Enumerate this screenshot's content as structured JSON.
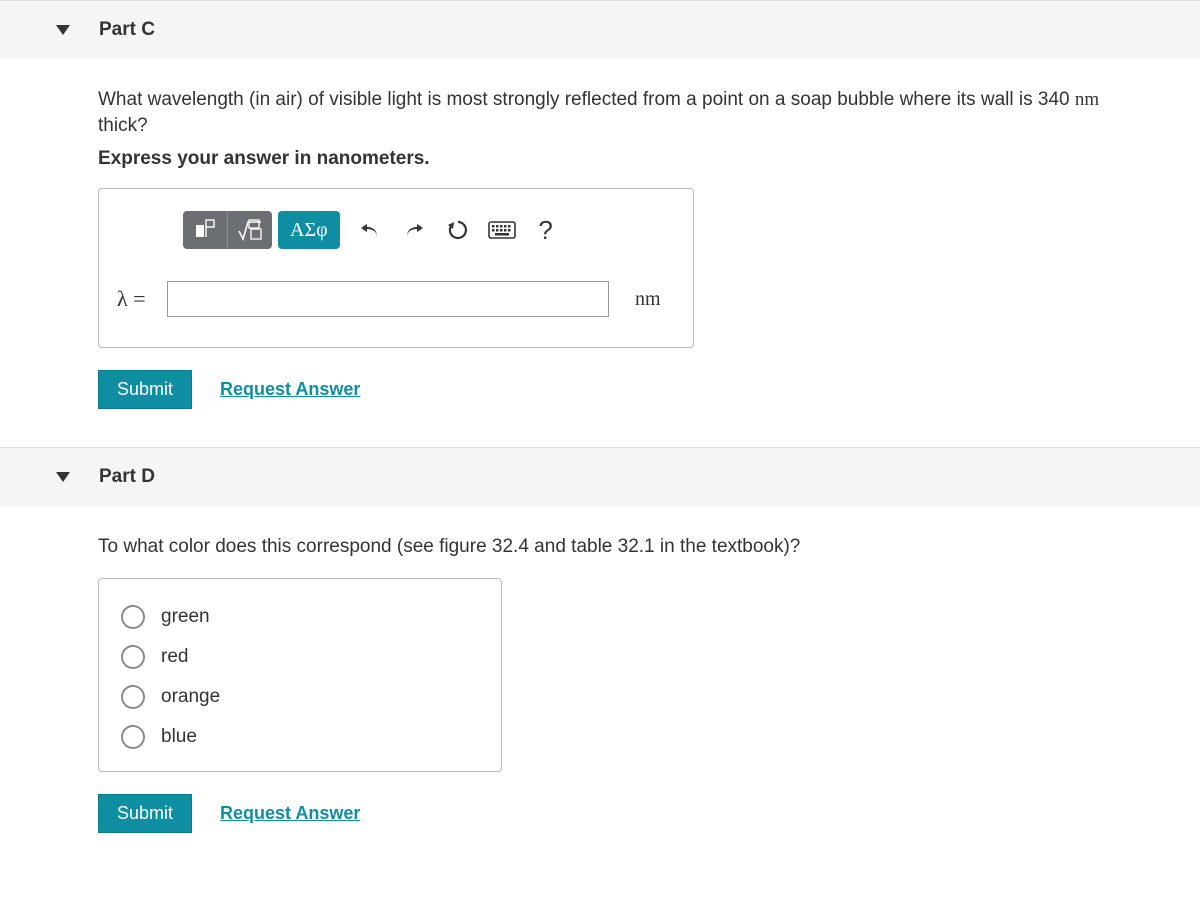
{
  "partC": {
    "title": "Part C",
    "question_pre": "What wavelength (in air) of visible light is most strongly reflected from a point on a soap bubble where its wall is 340 ",
    "question_unit": "nm",
    "question_post": " thick?",
    "instruction": "Express your answer in nanometers.",
    "greek_button": "ΑΣφ",
    "var_label": "λ =",
    "answer_value": "",
    "unit_label": "nm",
    "submit": "Submit",
    "request": "Request Answer"
  },
  "partD": {
    "title": "Part D",
    "question": "To what color does this correspond (see figure 32.4 and table 32.1 in the textbook)?",
    "options": [
      "green",
      "red",
      "orange",
      "blue"
    ],
    "submit": "Submit",
    "request": "Request Answer"
  }
}
